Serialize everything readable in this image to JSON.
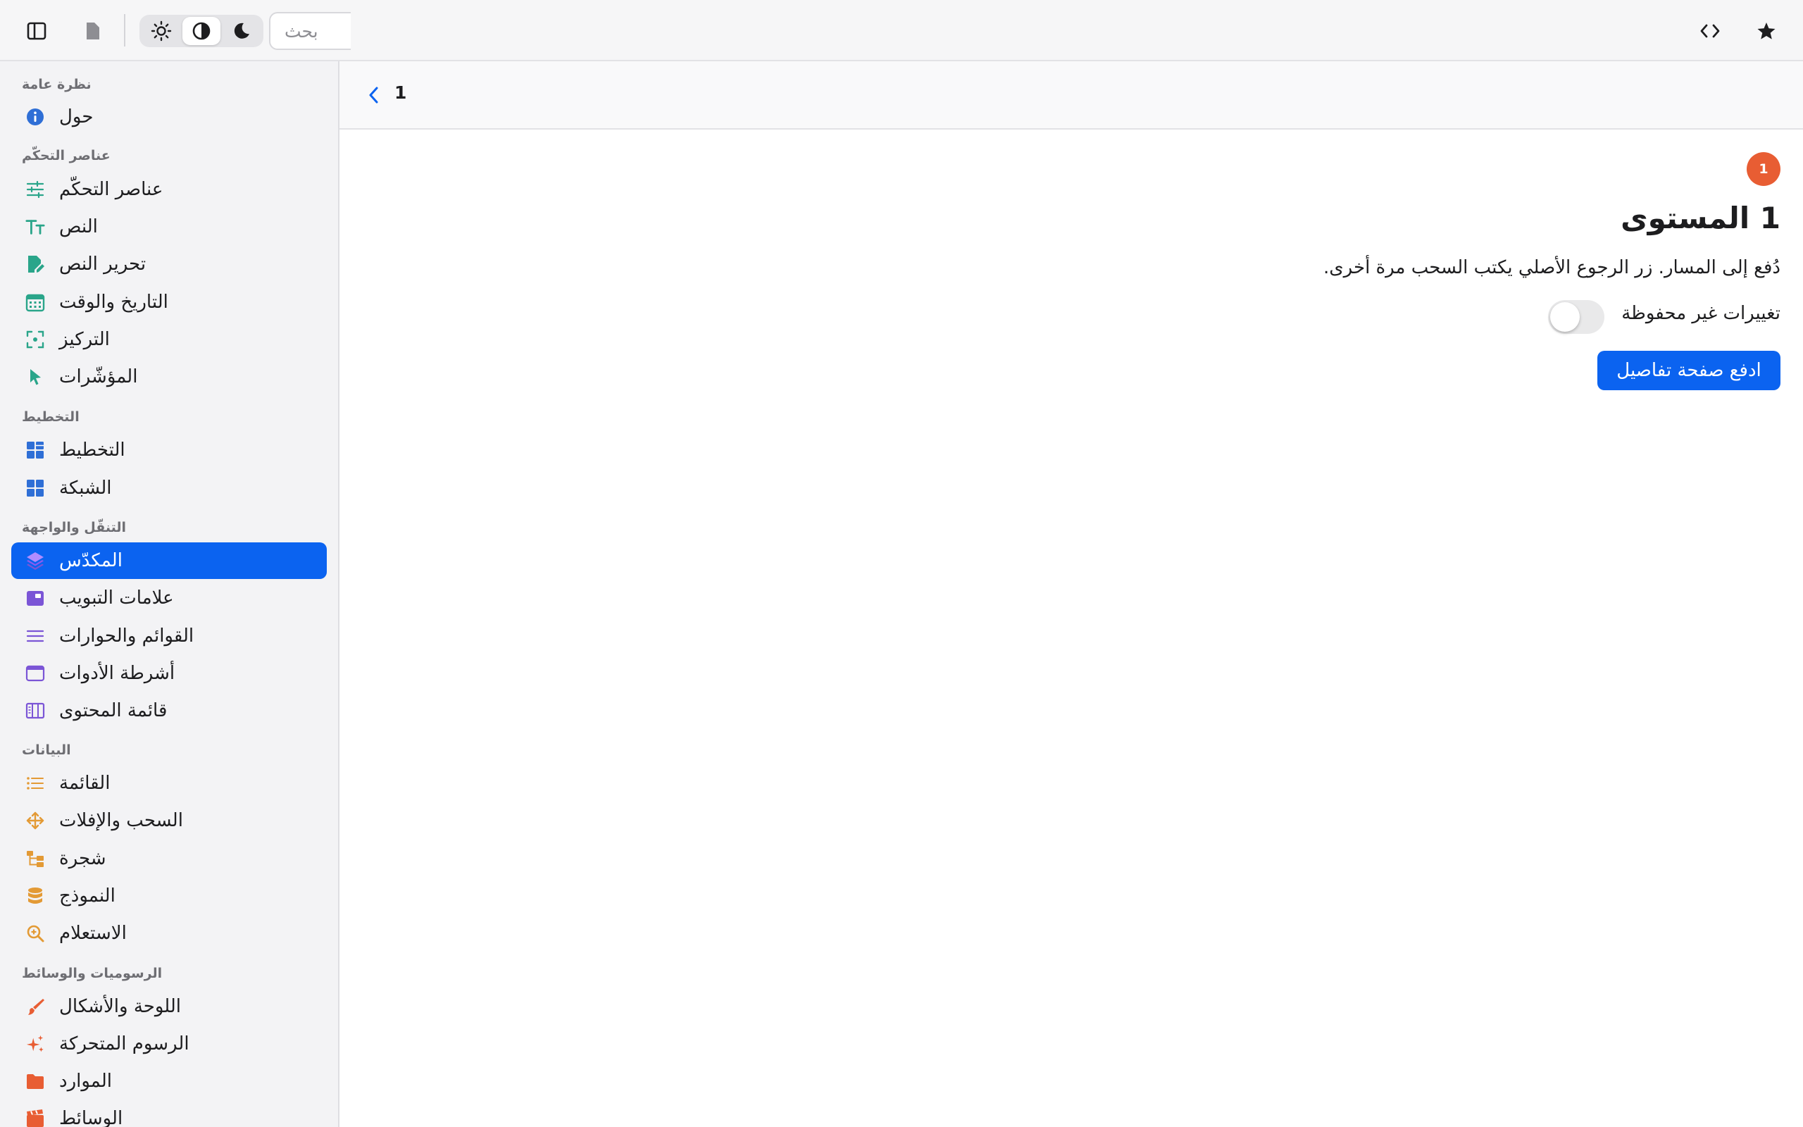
{
  "toolbar": {
    "search_placeholder": "بحث",
    "icons": {
      "sidebar_toggle": "sidebar-icon",
      "document": "document-icon",
      "light": "sun-icon",
      "auto": "contrast-icon",
      "dark": "moon-icon",
      "code": "code-icon",
      "favorite": "star-icon"
    },
    "appearance_selected": "auto"
  },
  "sidebar": {
    "sections": [
      {
        "title": "نظرة عامة",
        "items": [
          {
            "label": "حول",
            "icon": "info-icon",
            "color": "#2f6fd6"
          }
        ]
      },
      {
        "title": "عناصر التحكّم",
        "items": [
          {
            "label": "عناصر التحكّم",
            "icon": "sliders-icon",
            "color": "#2aa58a"
          },
          {
            "label": "النص",
            "icon": "text-size-icon",
            "color": "#2aa58a"
          },
          {
            "label": "تحرير النص",
            "icon": "doc-edit-icon",
            "color": "#2aa58a"
          },
          {
            "label": "التاريخ والوقت",
            "icon": "calendar-icon",
            "color": "#2aa58a"
          },
          {
            "label": "التركيز",
            "icon": "focus-icon",
            "color": "#2aa58a"
          },
          {
            "label": "المؤشّرات",
            "icon": "pointer-icon",
            "color": "#2aa58a"
          }
        ]
      },
      {
        "title": "التخطيط",
        "items": [
          {
            "label": "التخطيط",
            "icon": "layout-icon",
            "color": "#2f6fd6"
          },
          {
            "label": "الشبكة",
            "icon": "grid-icon",
            "color": "#2f6fd6"
          }
        ]
      },
      {
        "title": "التنقّل والواجهة",
        "items": [
          {
            "label": "المكدّس",
            "icon": "stack-icon",
            "color": "#7b55d6",
            "active": true
          },
          {
            "label": "علامات التبويب",
            "icon": "tabs-icon",
            "color": "#7b55d6"
          },
          {
            "label": "القوائم والحوارات",
            "icon": "menu-lines-icon",
            "color": "#7b55d6"
          },
          {
            "label": "أشرطة الأدوات",
            "icon": "window-icon",
            "color": "#7b55d6"
          },
          {
            "label": "قائمة المحتوى",
            "icon": "columns-icon",
            "color": "#7b55d6"
          }
        ]
      },
      {
        "title": "البيانات",
        "items": [
          {
            "label": "القائمة",
            "icon": "list-icon",
            "color": "#e39a35"
          },
          {
            "label": "السحب والإفلات",
            "icon": "move-icon",
            "color": "#e39a35"
          },
          {
            "label": "شجرة",
            "icon": "tree-icon",
            "color": "#e39a35"
          },
          {
            "label": "النموذج",
            "icon": "database-icon",
            "color": "#e39a35"
          },
          {
            "label": "الاستعلام",
            "icon": "zoom-icon",
            "color": "#e39a35"
          }
        ]
      },
      {
        "title": "الرسوميات والوسائط",
        "items": [
          {
            "label": "اللوحة والأشكال",
            "icon": "brush-icon",
            "color": "#e85d33"
          },
          {
            "label": "الرسوم المتحركة",
            "icon": "sparkles-icon",
            "color": "#e85d33"
          },
          {
            "label": "الموارد",
            "icon": "folder-icon",
            "color": "#e85d33"
          },
          {
            "label": "الوسائط",
            "icon": "film-icon",
            "color": "#e85d33"
          }
        ]
      }
    ]
  },
  "main": {
    "nav_title": "1",
    "badge": "1",
    "heading": "1 المستوى",
    "description": "دُفع إلى المسار. زر الرجوع الأصلي يكتب السحب مرة أخرى.",
    "toggle_label": "تغييرات غير محفوظة",
    "toggle_on": false,
    "push_button": "ادفع صفحة تفاصيل"
  },
  "colors": {
    "accent": "#0b63f0",
    "badge": "#e85d33"
  }
}
